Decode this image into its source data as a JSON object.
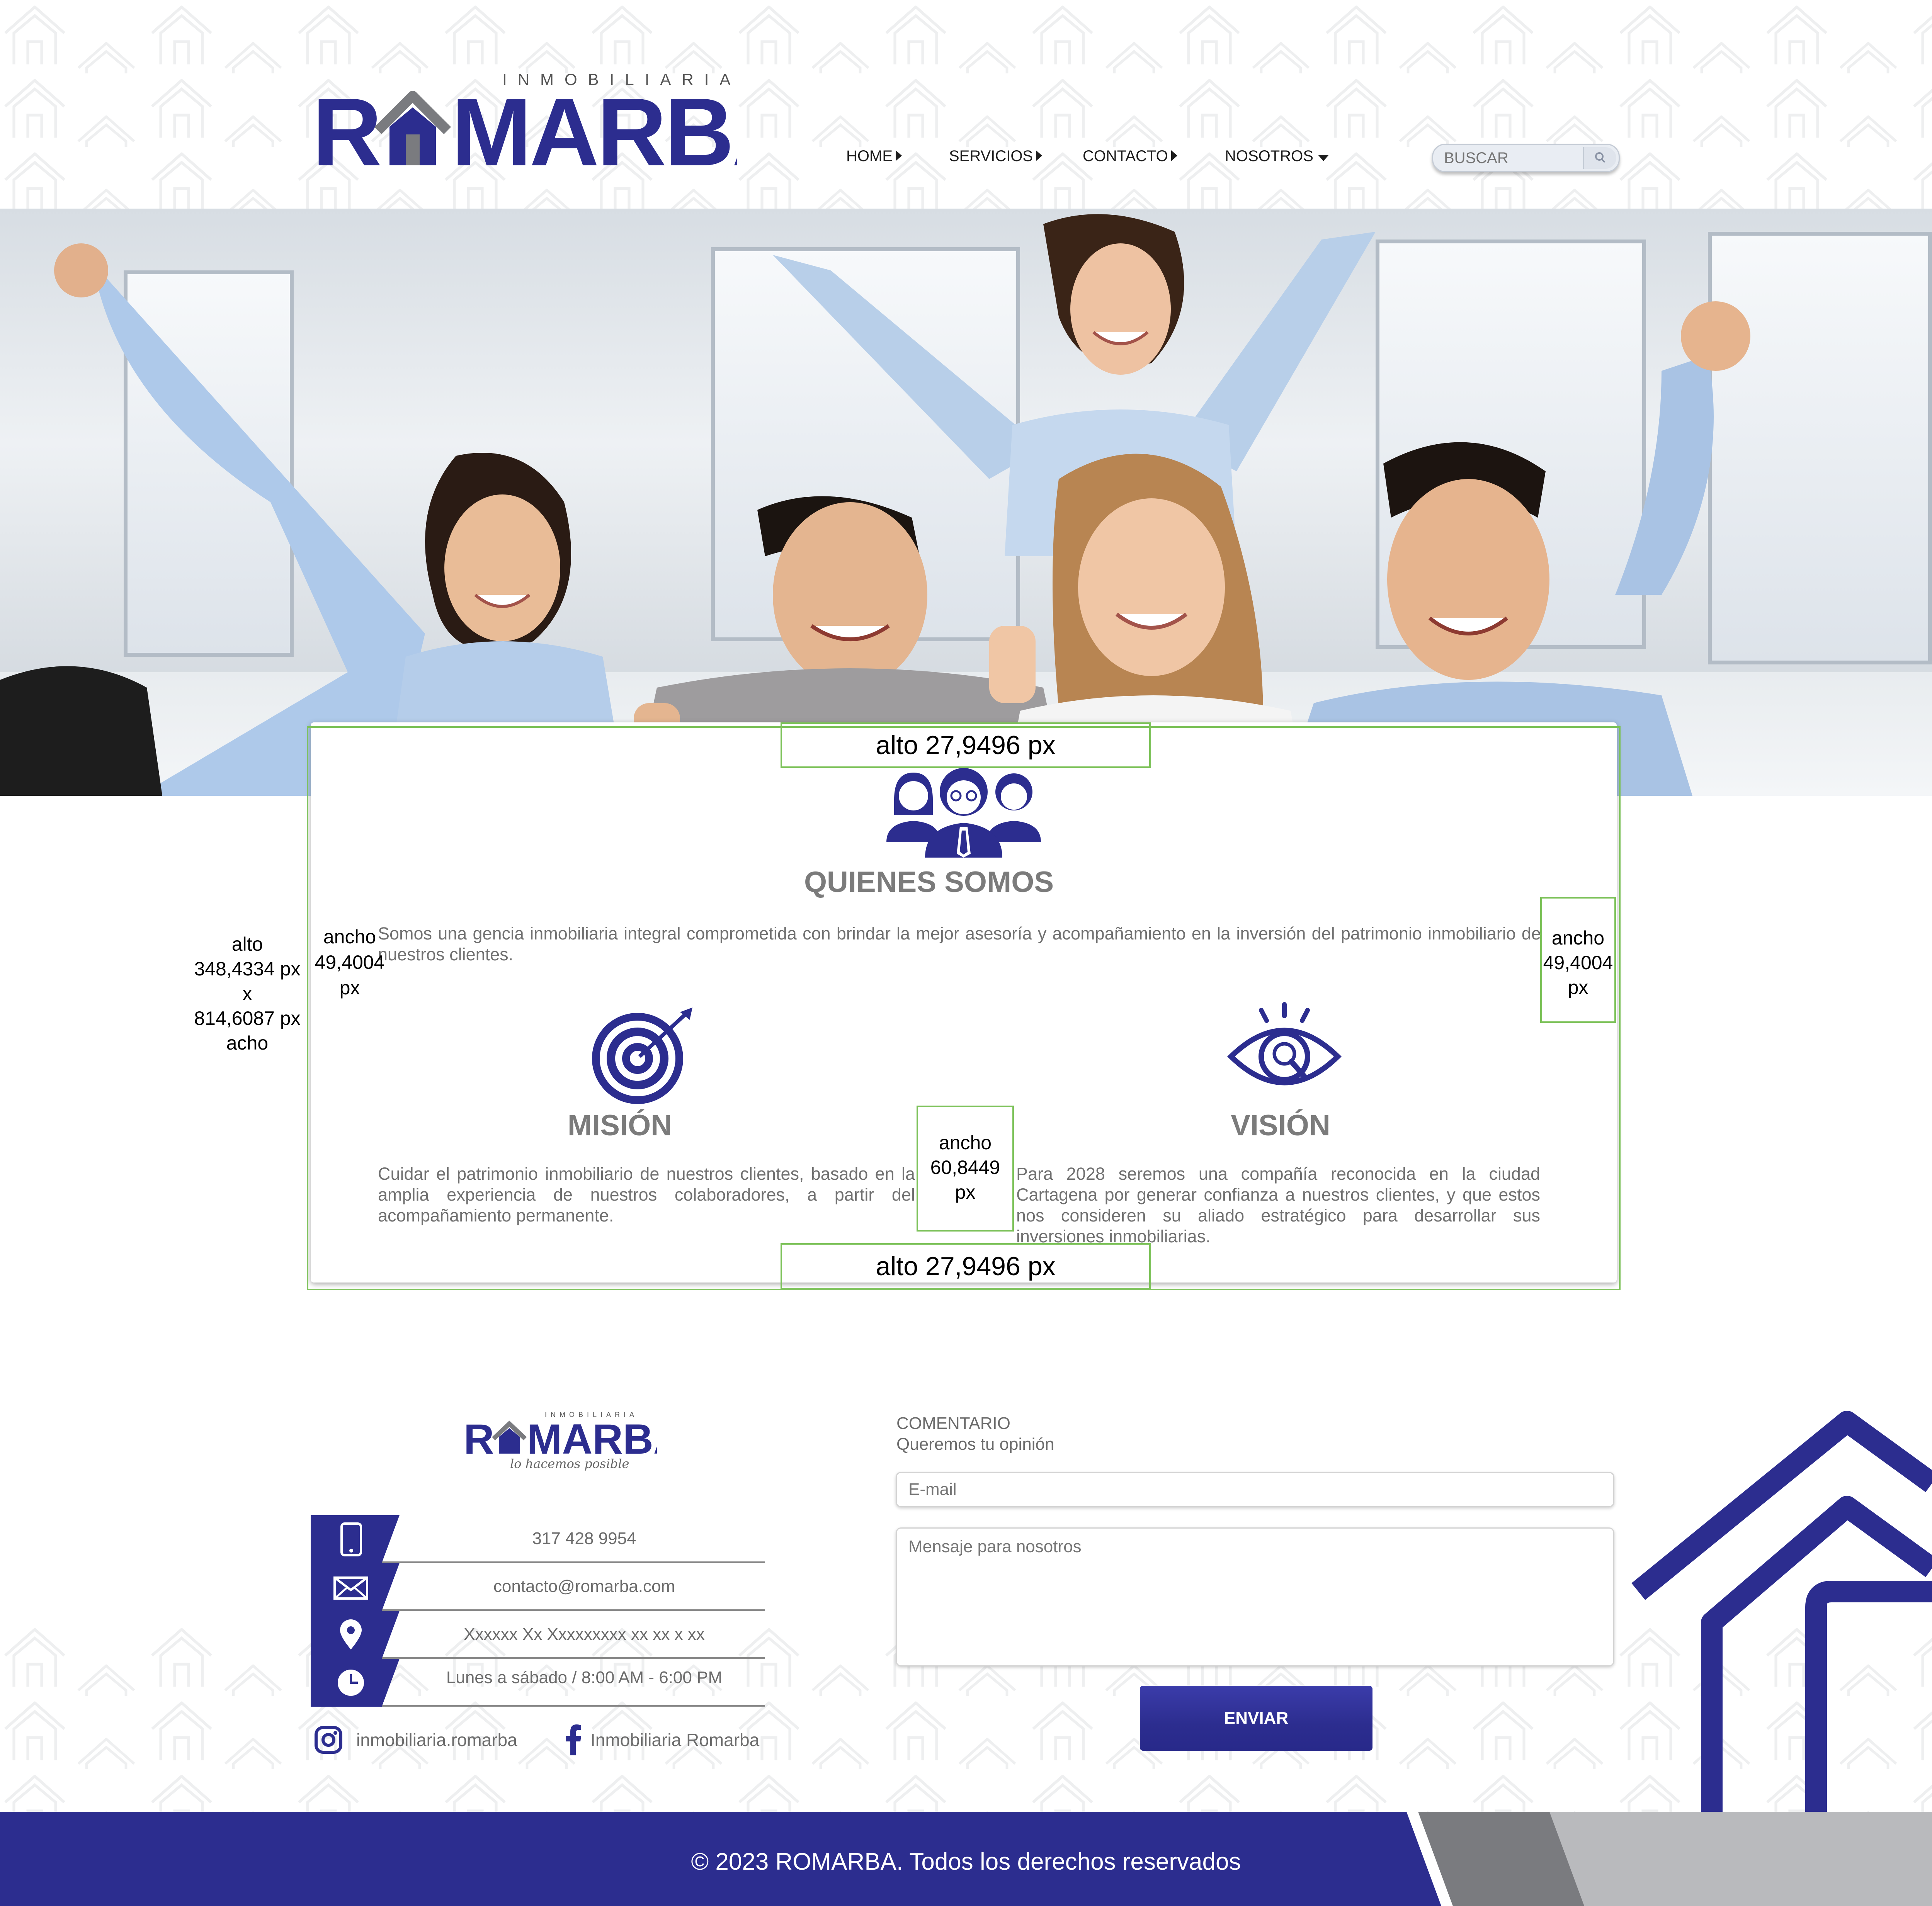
{
  "brand": {
    "name": "ROMARBA",
    "subtitle": "INMOBILIARIA",
    "tagline": "lo hacemos posible",
    "primary_color": "#2c2d8f",
    "secondary_color": "#7a7b7f"
  },
  "nav": {
    "items": [
      {
        "label": "HOME",
        "caret": "right"
      },
      {
        "label": "SERVICIOS",
        "caret": "right"
      },
      {
        "label": "CONTACTO",
        "caret": "right"
      },
      {
        "label": "NOSOTROS",
        "caret": "down"
      }
    ]
  },
  "search": {
    "placeholder": "BUSCAR",
    "icon": "search-icon"
  },
  "about": {
    "title": "QUIENES SOMOS",
    "text": "Somos una gencia inmobiliaria integral comprometida con brindar la mejor asesoría y acompañamiento en la inversión del patrimonio inmobiliario de nuestros clientes.",
    "icon": "team-icon"
  },
  "mission": {
    "title": "MISIÓN",
    "text": "Cuidar el patrimonio inmobiliario de nuestros clientes, basado en la amplia experiencia de nuestros colaboradores, a partir del acompañamiento permanente.",
    "icon": "target-icon"
  },
  "vision": {
    "title": "VISIÓN",
    "text": "Para 2028 seremos una compañía reconocida en la ciudad Cartagena por generar confianza a nuestros clientes, y que estos nos consideren su aliado estratégico para desarrollar sus inversiones inmobiliarias.",
    "icon": "eye-search-icon"
  },
  "annotations": {
    "top": "alto 27,9496 px",
    "bottom": "alto 27,9496 px",
    "left_outer": [
      "alto",
      "348,4334 px",
      "x",
      "814,6087 px",
      "acho"
    ],
    "left_inner": [
      "ancho",
      "49,4004",
      "px"
    ],
    "right_inner": [
      "ancho",
      "49,4004",
      "px"
    ],
    "middle": [
      "ancho",
      "60,8449 px"
    ]
  },
  "contact": {
    "phone": "317 428 9954",
    "email": "contacto@romarba.com",
    "address": "Xxxxxx Xx Xxxxxxxxx xx xx x xx",
    "hours": "Lunes a sábado / 8:00 AM - 6:00 PM",
    "instagram": "inmobiliaria.romarba",
    "facebook": "Inmobiliaria Romarba"
  },
  "comment_form": {
    "title": "COMENTARIO",
    "subtitle": "Queremos tu opinión",
    "email_placeholder": "E-mail",
    "message_placeholder": "Mensaje para nosotros",
    "submit_label": "ENVIAR"
  },
  "footer": {
    "copyright": "© 2023 ROMARBA. Todos los derechos reservados"
  }
}
